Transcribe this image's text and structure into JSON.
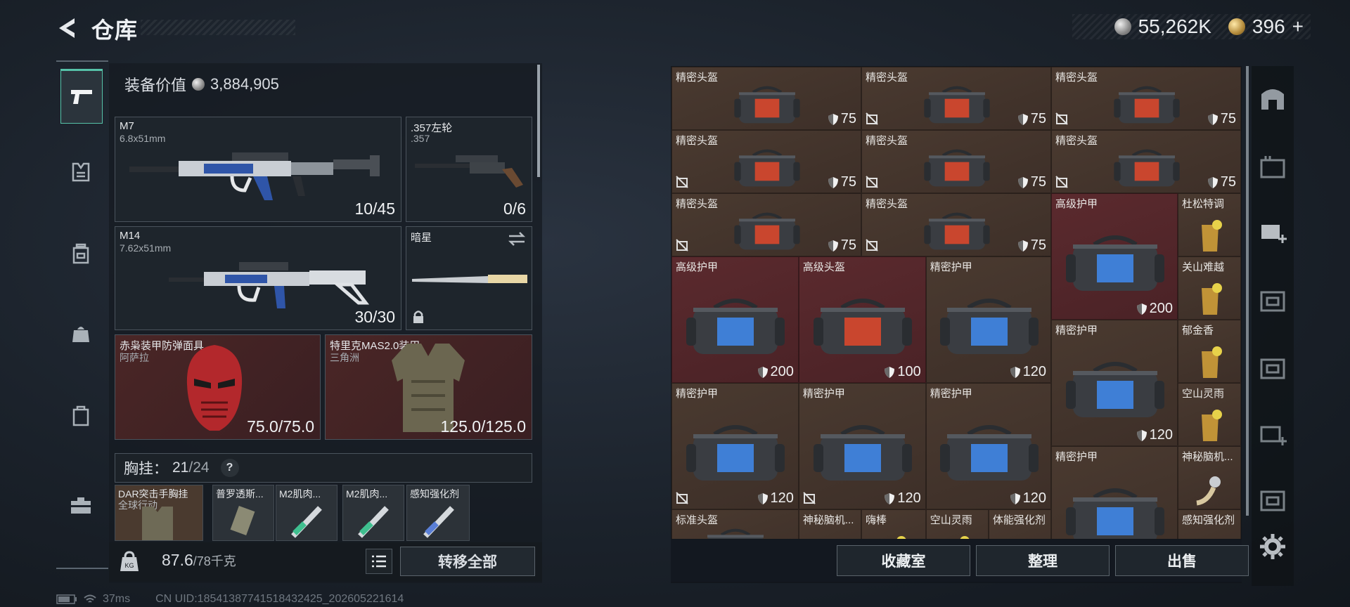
{
  "header": {
    "title": "仓库",
    "currency_silver": "55,262K",
    "currency_gold": "396",
    "plus": "+"
  },
  "equipment": {
    "value_label": "装备价值",
    "value": "3,884,905",
    "primary_weapon": {
      "name": "M7",
      "caliber": "6.8x51mm",
      "ammo": "10/45"
    },
    "sidearm": {
      "name": ".357左轮",
      "caliber": ".357",
      "ammo": "0/6"
    },
    "secondary_weapon": {
      "name": "M14",
      "caliber": "7.62x51mm",
      "ammo": "30/30"
    },
    "melee": {
      "name": "暗星"
    },
    "helmet": {
      "name": "赤枭装甲防弹面具",
      "sub": "阿萨拉",
      "durability": "75.0/75.0"
    },
    "armor": {
      "name": "特里克MAS2.0装甲",
      "sub": "三角洲",
      "durability": "125.0/125.0"
    },
    "chest_rig": {
      "label": "胸挂：",
      "used": "21",
      "total": "/24",
      "help": "?"
    },
    "pouches": [
      {
        "name": "DAR突击手胸挂",
        "sub": "全球行动"
      },
      {
        "name": "普罗透斯..."
      },
      {
        "name": "M2肌肉..."
      },
      {
        "name": "M2肌肉..."
      },
      {
        "name": "感知强化剂"
      }
    ],
    "weight": "87.6",
    "weight_max": "/78千克",
    "transfer_all": "转移全部"
  },
  "inventory": {
    "items": [
      {
        "name": "精密头盔",
        "dur": "75"
      },
      {
        "name": "精密头盔",
        "dur": "75"
      },
      {
        "name": "精密头盔",
        "dur": "75"
      },
      {
        "name": "精密头盔",
        "dur": "75"
      },
      {
        "name": "精密头盔",
        "dur": "75"
      },
      {
        "name": "精密头盔",
        "dur": "75"
      },
      {
        "name": "精密头盔",
        "dur": "75"
      },
      {
        "name": "精密头盔",
        "dur": "75"
      },
      {
        "name": "高级护甲",
        "dur": "200"
      },
      {
        "name": "杜松特调"
      },
      {
        "name": "高级护甲",
        "dur": "200"
      },
      {
        "name": "高级头盔",
        "dur": "100"
      },
      {
        "name": "精密护甲",
        "dur": "120"
      },
      {
        "name": "关山难越"
      },
      {
        "name": "精密护甲",
        "dur": "120"
      },
      {
        "name": "郁金香"
      },
      {
        "name": "精密护甲",
        "dur": "120"
      },
      {
        "name": "精密护甲",
        "dur": "120"
      },
      {
        "name": "精密护甲",
        "dur": "120"
      },
      {
        "name": "空山灵雨"
      },
      {
        "name": "精密护甲"
      },
      {
        "name": "神秘脑机..."
      },
      {
        "name": "标准头盔"
      },
      {
        "name": "神秘脑机..."
      },
      {
        "name": "嗨棒"
      },
      {
        "name": "空山灵雨"
      },
      {
        "name": "体能强化剂"
      },
      {
        "name": "感知强化剂"
      }
    ],
    "buttons": {
      "collection": "收藏室",
      "sort": "整理",
      "sell": "出售"
    }
  },
  "status": {
    "ping": "37ms",
    "uid": "CN UID:185413877415184324​25_202605221614"
  }
}
